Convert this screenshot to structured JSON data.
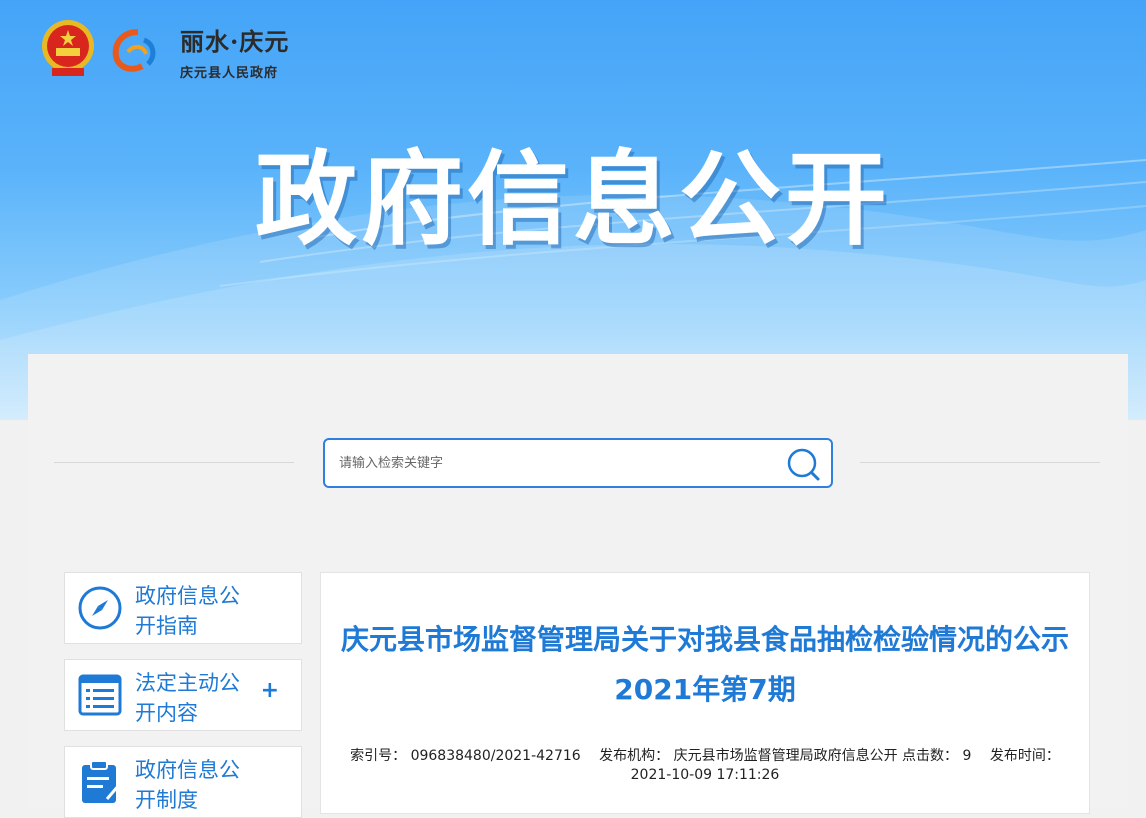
{
  "header": {
    "brand_title": "丽水·庆元",
    "brand_subtitle": "庆元县人民政府",
    "hero_title": "政府信息公开"
  },
  "search": {
    "placeholder": "请输入检索关键字",
    "value": "",
    "icon": "search-icon"
  },
  "sidebar": {
    "items": [
      {
        "label": "政府信息公开指南",
        "icon": "compass-icon",
        "expandable": false
      },
      {
        "label": "法定主动公开内容",
        "icon": "list-icon",
        "expandable": true,
        "expand_symbol": "+"
      },
      {
        "label": "政府信息公开制度",
        "icon": "clipboard-icon",
        "expandable": false
      }
    ]
  },
  "article": {
    "title": "庆元县市场监督管理局关于对我县食品抽检检验情况的公示2021年第7期",
    "meta": {
      "index_label": "索引号：",
      "index_value": "096838480/2021-42716",
      "publisher_label": "发布机构：",
      "publisher_value": "庆元县市场监督管理局政府信息公开",
      "clicks_label": "点击数：",
      "clicks_value": "9",
      "date_label": "发布时间：",
      "date_value": "2021-10-09 17:11:26"
    }
  },
  "colors": {
    "accent": "#1f7ad6",
    "banner_top": "#45a4f8",
    "panel_bg": "#f2f2f2"
  }
}
